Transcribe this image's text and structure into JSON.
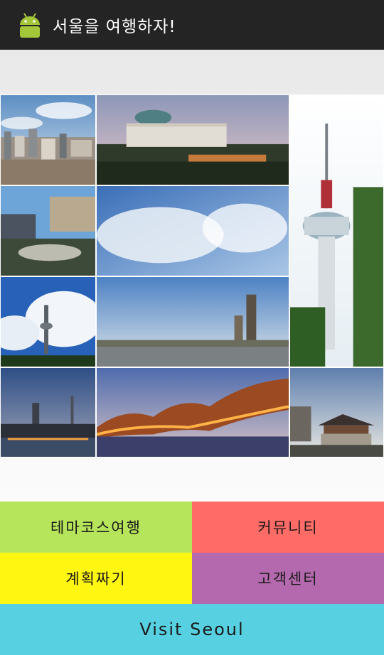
{
  "app": {
    "title": "서울을 여행하자!",
    "icon": "android-robot-icon"
  },
  "colors": {
    "actionbar": "#242424",
    "theme_course": "#b6e45a",
    "community": "#ff6b66",
    "planning": "#fff612",
    "customer_center": "#b469ae",
    "visit_seoul": "#57d1e2"
  },
  "menu": {
    "theme_course": "테마코스여행",
    "community": "커뮤니티",
    "planning": "계획짜기",
    "customer_center": "고객센터",
    "visit_seoul": "Visit Seoul"
  }
}
